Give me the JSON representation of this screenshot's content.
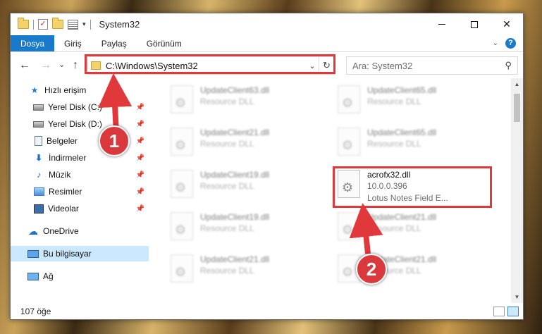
{
  "window": {
    "title": "System32",
    "controls": {
      "minimize_icon": "minimize-icon",
      "maximize_icon": "maximize-icon",
      "close_glyph": "✕"
    }
  },
  "ribbon": {
    "tabs": [
      "Dosya",
      "Giriş",
      "Paylaş",
      "Görünüm"
    ],
    "accent": "#1979ca"
  },
  "nav": {
    "back": "←",
    "forward": "→",
    "recent": "⌄",
    "up": "↑",
    "address_path": "C:\\Windows\\System32",
    "search_placeholder": "Ara: System32"
  },
  "sidebar": {
    "items": [
      {
        "label": "Hızlı erişim",
        "icon": "star-icon",
        "pinned": false
      },
      {
        "label": "Yerel Disk (C:)",
        "icon": "drive-icon",
        "pinned": true
      },
      {
        "label": "Yerel Disk (D:)",
        "icon": "drive-icon",
        "pinned": true
      },
      {
        "label": "Belgeler",
        "icon": "documents-icon",
        "pinned": true
      },
      {
        "label": "İndirmeler",
        "icon": "downloads-icon",
        "pinned": true
      },
      {
        "label": "Müzik",
        "icon": "music-icon",
        "pinned": true
      },
      {
        "label": "Resimler",
        "icon": "pictures-icon",
        "pinned": true
      },
      {
        "label": "Videolar",
        "icon": "videos-icon",
        "pinned": true
      },
      {
        "label": "OneDrive",
        "icon": "cloud-icon",
        "pinned": false
      },
      {
        "label": "Bu bilgisayar",
        "icon": "computer-icon",
        "pinned": false,
        "selected": true
      },
      {
        "label": "Ağ",
        "icon": "network-icon",
        "pinned": false
      }
    ]
  },
  "files": [
    {
      "name": "UpdateClient63.dll",
      "type": "Resource DLL",
      "blurred": true
    },
    {
      "name": "UpdateClient65.dll",
      "type": "Resource DLL",
      "blurred": true
    },
    {
      "name": "UpdateClient21.dll",
      "type": "Resource DLL",
      "blurred": true
    },
    {
      "name": "UpdateClient65.dll",
      "type": "Resource DLL",
      "blurred": true
    },
    {
      "name": "UpdateClient19.dll",
      "type": "Resource DLL",
      "blurred": true
    },
    {
      "name": "acrofx32.dll",
      "version": "10.0.0.396",
      "description": "Lotus Notes Field E...",
      "blurred": false
    },
    {
      "name": "UpdateClient19.dll",
      "type": "Resource DLL",
      "blurred": true
    },
    {
      "name": "UpdateClient21.dll",
      "type": "Resource DLL",
      "blurred": true
    },
    {
      "name": "UpdateClient21.dll",
      "type": "Resource DLL",
      "blurred": true
    },
    {
      "name": "UpdateClient21.dll",
      "type": "Resource DLL",
      "blurred": true
    }
  ],
  "status": {
    "item_count": "107 öğe"
  },
  "annotations": {
    "color": "#e0383b",
    "markers": [
      "1",
      "2"
    ]
  }
}
